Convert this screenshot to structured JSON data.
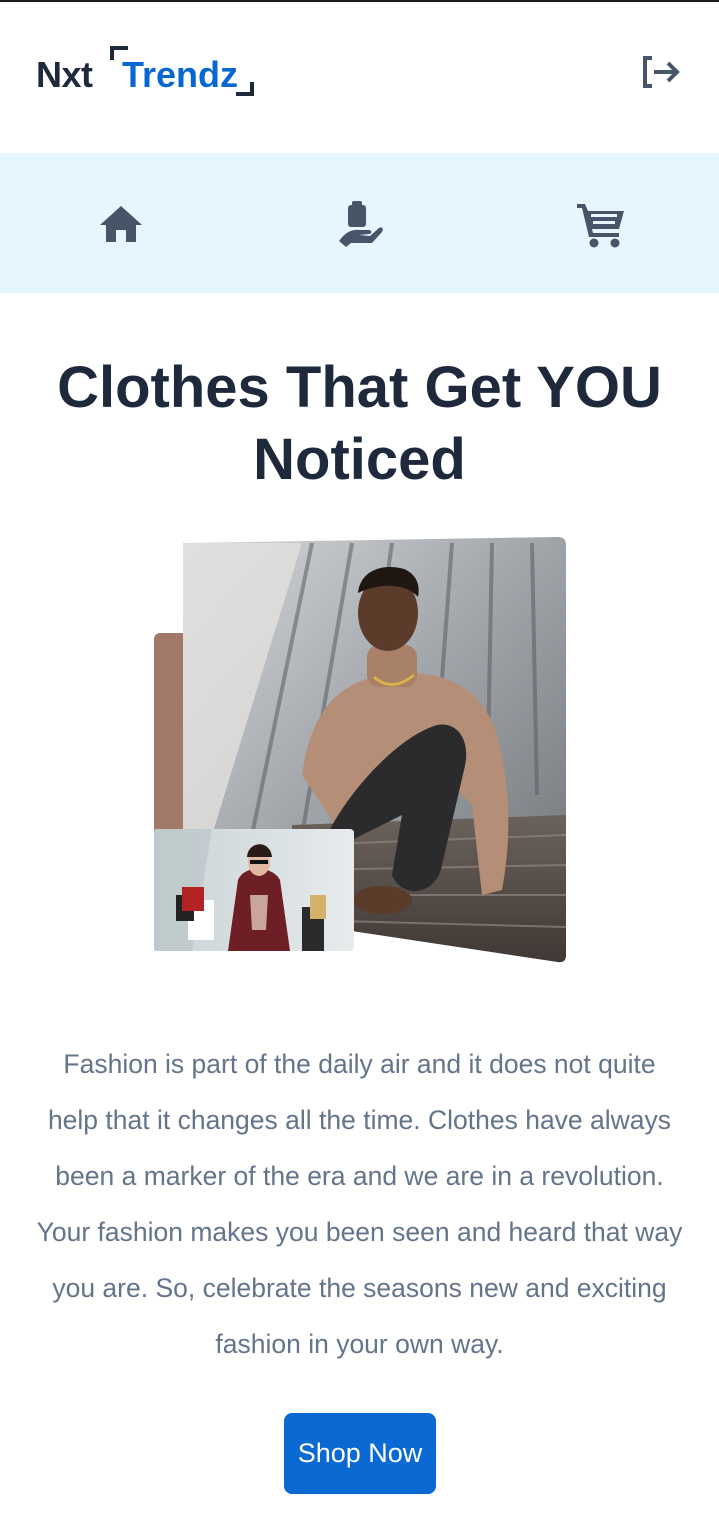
{
  "app": {
    "logo_prefix": "Nxt",
    "logo_suffix": "Trendz"
  },
  "header": {
    "logout_icon": "logout-icon"
  },
  "nav": {
    "items": [
      {
        "icon": "home-icon"
      },
      {
        "icon": "products-icon"
      },
      {
        "icon": "cart-icon"
      }
    ]
  },
  "main": {
    "headline": "Clothes That Get YOU Noticed",
    "description": "Fashion is part of the daily air and it does not quite help that it changes all the time. Clothes have always been a marker of the era and we are in a revolution. Your fashion makes you been seen and heard that way you are. So, celebrate the seasons new and exciting fashion in your own way.",
    "shop_button": "Shop Now"
  },
  "colors": {
    "brand_blue": "#0967d2",
    "dark_text": "#1e293b",
    "muted_text": "#64748b",
    "nav_band": "#e6f6ff",
    "icon_gray": "#475569"
  }
}
